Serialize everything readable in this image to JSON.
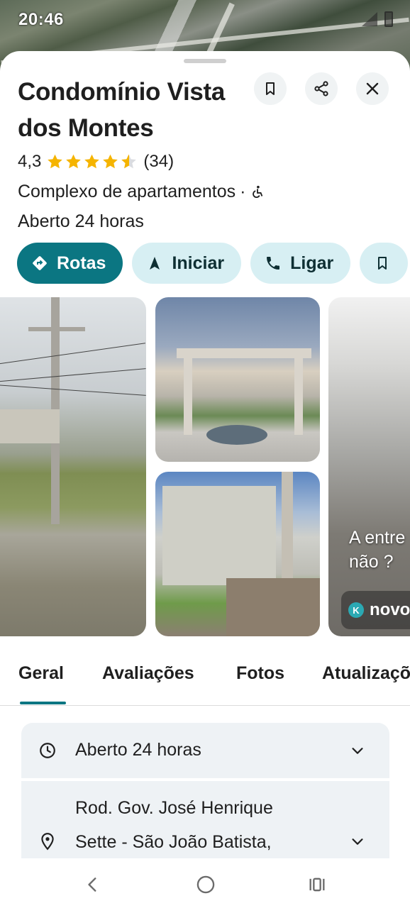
{
  "status_bar": {
    "time": "20:46"
  },
  "place": {
    "title": "Condomínio Vista dos Montes",
    "rating": "4,3",
    "rating_value": 4.3,
    "review_count": "(34)",
    "category": "Complexo de apartamentos",
    "category_separator": "·",
    "hours": "Aberto 24 horas"
  },
  "actions": {
    "save_icon": "bookmark-icon",
    "share_icon": "share-icon",
    "close_icon": "close-icon"
  },
  "chips": [
    {
      "label": "Rotas",
      "icon": "directions-icon"
    },
    {
      "label": "Iniciar",
      "icon": "navigation-arrow-icon"
    },
    {
      "label": "Ligar",
      "icon": "phone-icon"
    },
    {
      "label": "",
      "icon": "bookmark-icon"
    }
  ],
  "photos": {
    "kitchen_overlay_line1": "A entre",
    "kitchen_overlay_line2": "não ?",
    "kitchen_badge_letter": "K",
    "kitchen_badge_label": "novo"
  },
  "tabs": [
    "Geral",
    "Avaliações",
    "Fotos",
    "Atualizaçõ"
  ],
  "info": {
    "hours_text": "Aberto 24 horas",
    "address_line1": "Rod. Gov. José Henrique",
    "address_line2": "Sette - São João Batista,"
  },
  "colors": {
    "accent": "#0b7682",
    "chip_secondary": "#d7eff3",
    "star": "#f5b400"
  }
}
